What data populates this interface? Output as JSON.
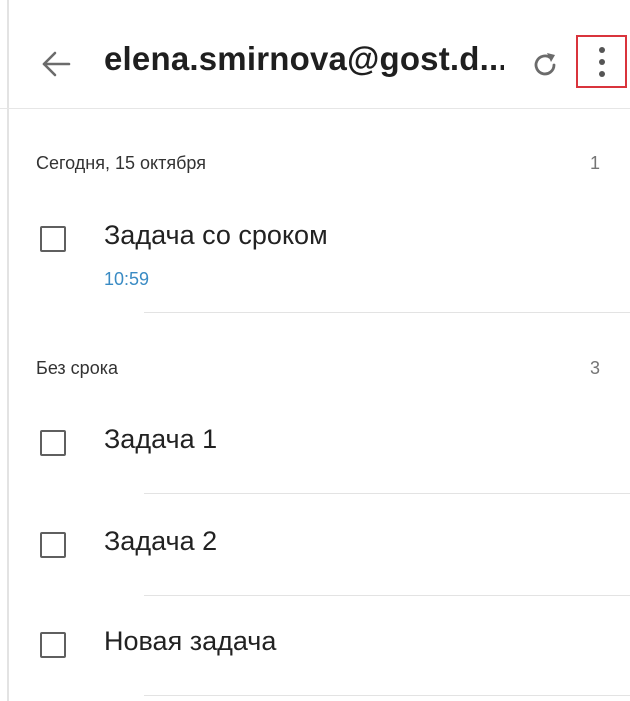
{
  "header": {
    "title": "elena.smirnova@gost.d...",
    "back_icon": "arrow-left-icon",
    "refresh_icon": "refresh-icon",
    "more_icon": "more-vertical-icon",
    "highlight_color": "#d9343c"
  },
  "sections": [
    {
      "label": "Сегодня, 15 октября",
      "count": "1",
      "tasks": [
        {
          "title": "Задача со сроком",
          "due": "10:59",
          "checked": false
        }
      ]
    },
    {
      "label": "Без срока",
      "count": "3",
      "tasks": [
        {
          "title": "Задача 1",
          "checked": false
        },
        {
          "title": "Задача 2",
          "checked": false
        },
        {
          "title": "Новая задача",
          "checked": false
        }
      ]
    }
  ],
  "colors": {
    "due_time": "#3a8bc4",
    "text": "#222222",
    "divider": "#e3e3e3"
  }
}
